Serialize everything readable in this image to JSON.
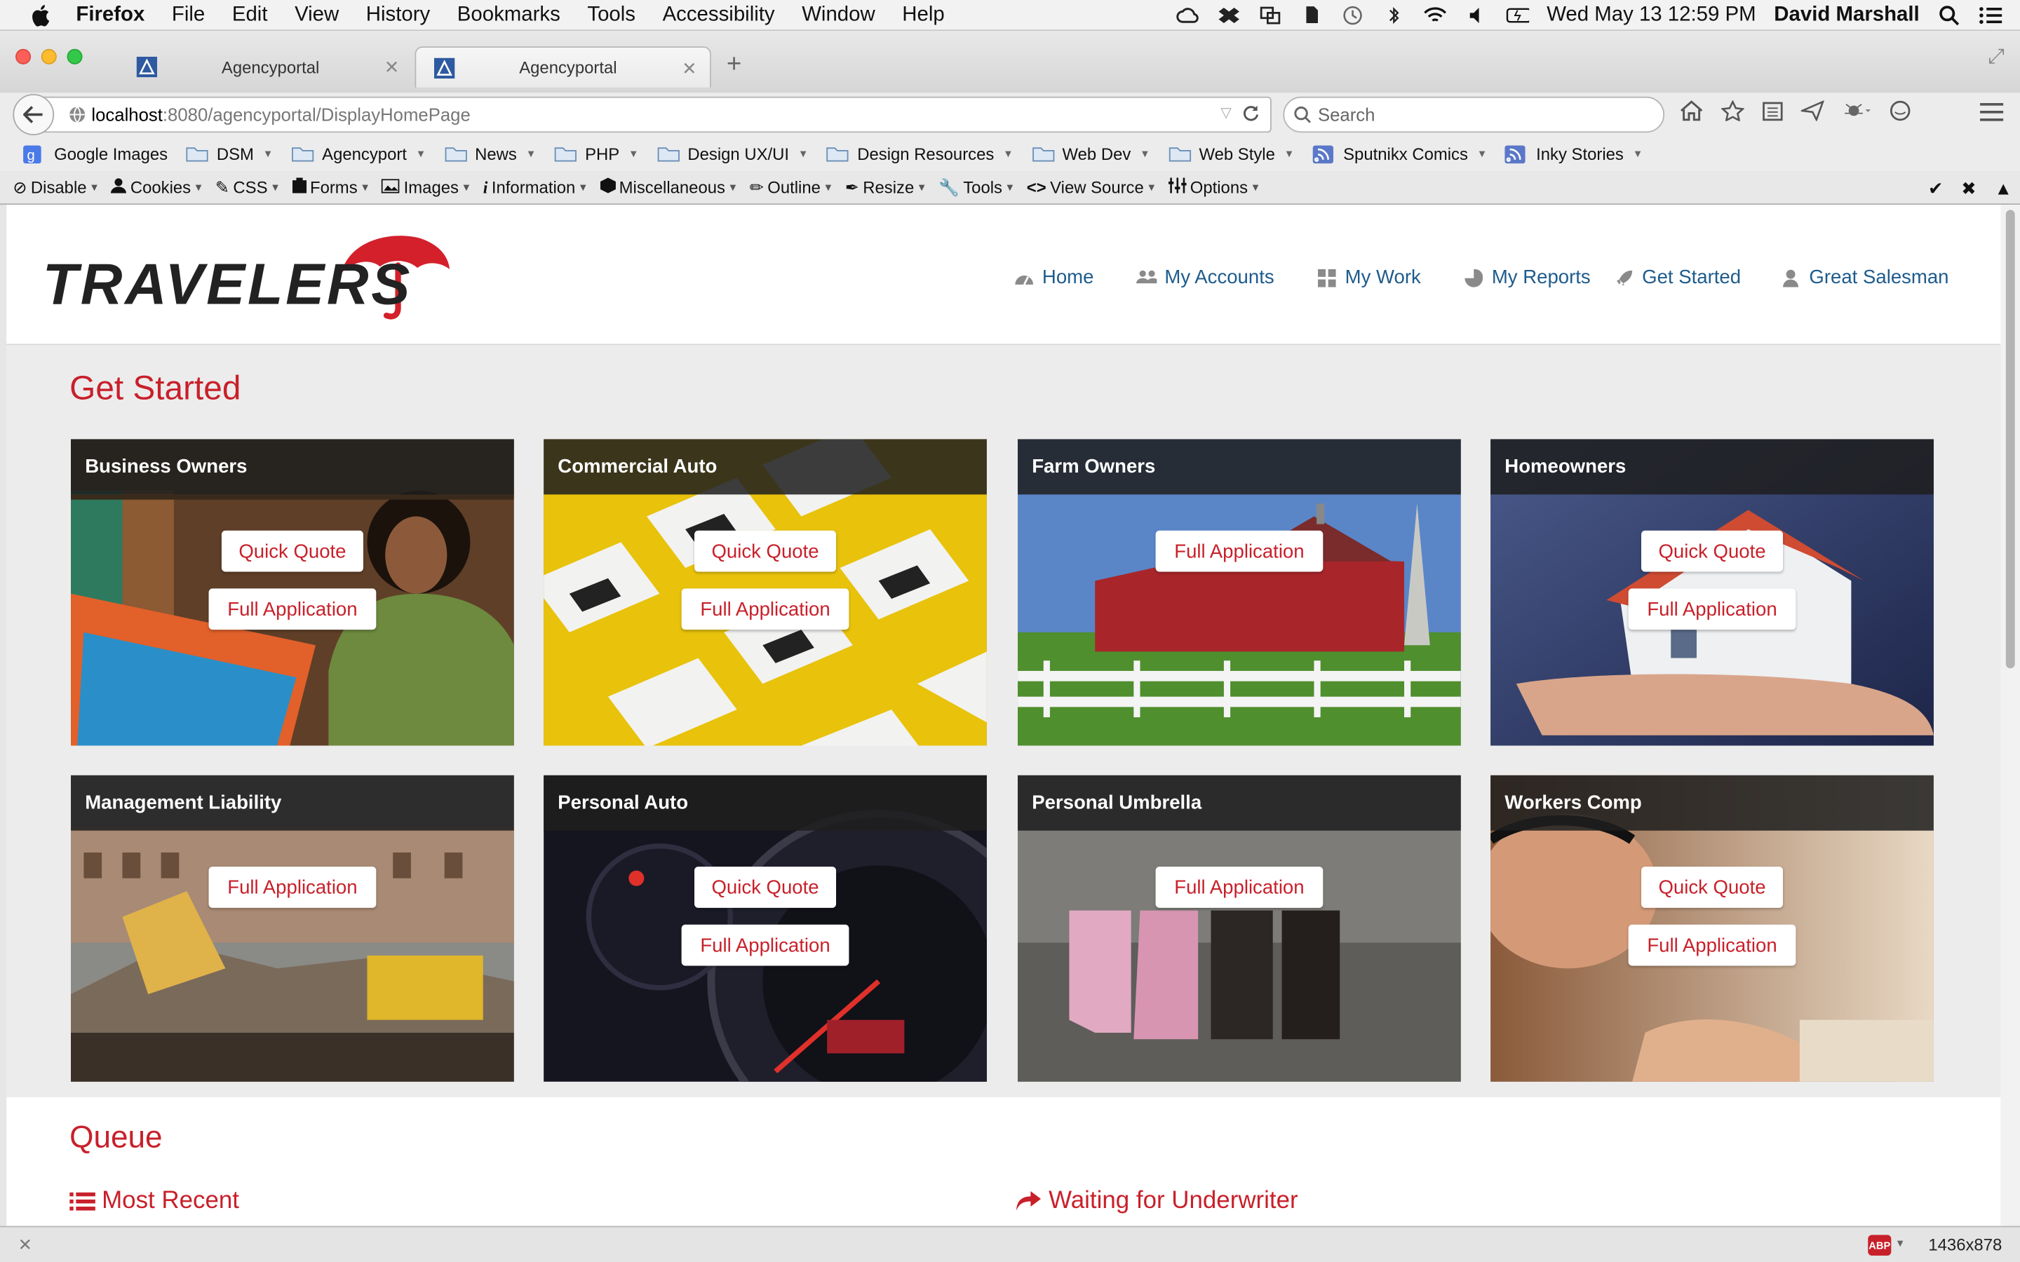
{
  "menubar": {
    "app": "Firefox",
    "items": [
      "File",
      "Edit",
      "View",
      "History",
      "Bookmarks",
      "Tools",
      "Accessibility",
      "Window",
      "Help"
    ],
    "clock": "Wed May 13  12:59 PM",
    "user": "David Marshall"
  },
  "tabs": [
    {
      "title": "Agencyportal"
    },
    {
      "title": "Agencyportal"
    }
  ],
  "url": {
    "host": "localhost",
    "path": ":8080/agencyportal/DisplayHomePage"
  },
  "search": {
    "placeholder": "Search"
  },
  "bookmarks": [
    "Google Images",
    "DSM",
    "Agencyport",
    "News",
    "PHP",
    "Design UX/UI",
    "Design Resources",
    "Web Dev",
    "Web Style",
    "Sputnikx Comics",
    "Inky Stories"
  ],
  "devtools": [
    "Disable",
    "Cookies",
    "CSS",
    "Forms",
    "Images",
    "Information",
    "Miscellaneous",
    "Outline",
    "Resize",
    "Tools",
    "View Source",
    "Options"
  ],
  "brand": "TRAVELERS",
  "nav": [
    "Home",
    "My Accounts",
    "My Work",
    "My Reports",
    "Get Started",
    "Great Salesman"
  ],
  "page": {
    "title": "Get Started",
    "quick_quote": "Quick Quote",
    "full_application": "Full Application"
  },
  "cards": [
    {
      "title": "Business Owners"
    },
    {
      "title": "Commercial Auto"
    },
    {
      "title": "Farm Owners"
    },
    {
      "title": "Homeowners"
    },
    {
      "title": "Management Liability"
    },
    {
      "title": "Personal Auto"
    },
    {
      "title": "Personal Umbrella"
    },
    {
      "title": "Workers Comp"
    }
  ],
  "queue": {
    "title": "Queue",
    "most_recent": "Most Recent",
    "waiting": "Waiting for Underwriter"
  },
  "status": {
    "dims": "1436x878",
    "abp": "ABP"
  },
  "colors": {
    "brand_red": "#c8202a",
    "nav_blue": "#1e5b8c"
  }
}
